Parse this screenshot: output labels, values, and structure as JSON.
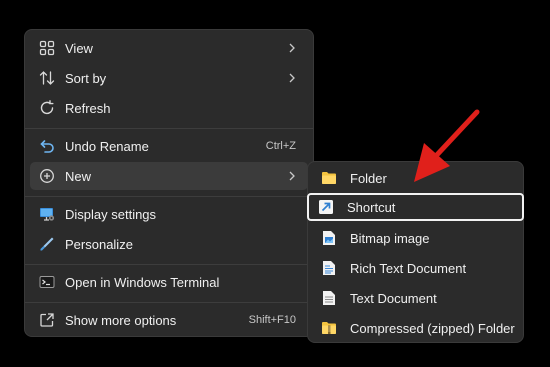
{
  "context_menu": {
    "items": [
      {
        "label": "View",
        "icon": "grid-view-icon"
      },
      {
        "label": "Sort by",
        "icon": "sort-arrows-icon"
      },
      {
        "label": "Refresh",
        "icon": "refresh-icon"
      },
      {
        "label": "Undo Rename",
        "icon": "undo-icon",
        "shortcut": "Ctrl+Z"
      },
      {
        "label": "New",
        "icon": "add-circle-icon"
      },
      {
        "label": "Display settings",
        "icon": "display-settings-icon"
      },
      {
        "label": "Personalize",
        "icon": "pen-brush-icon"
      },
      {
        "label": "Open in Windows Terminal",
        "icon": "terminal-icon"
      },
      {
        "label": "Show more options",
        "icon": "open-external-icon",
        "shortcut": "Shift+F10"
      }
    ]
  },
  "new_submenu": {
    "items": [
      {
        "label": "Folder",
        "icon": "folder-icon"
      },
      {
        "label": "Shortcut",
        "icon": "shortcut-arrow-icon"
      },
      {
        "label": "Bitmap image",
        "icon": "bitmap-file-icon"
      },
      {
        "label": "Rich Text Document",
        "icon": "rich-text-file-icon"
      },
      {
        "label": "Text Document",
        "icon": "text-file-icon"
      },
      {
        "label": "Compressed (zipped) Folder",
        "icon": "zipped-folder-icon"
      }
    ]
  },
  "colors": {
    "menu_bg": "#2b2b2b",
    "annotation_arrow": "#e0201b",
    "highlight_border": "#f2f2f2",
    "folder_yellow": "#f3c33f",
    "shortcut_blue": "#3a88d8"
  }
}
